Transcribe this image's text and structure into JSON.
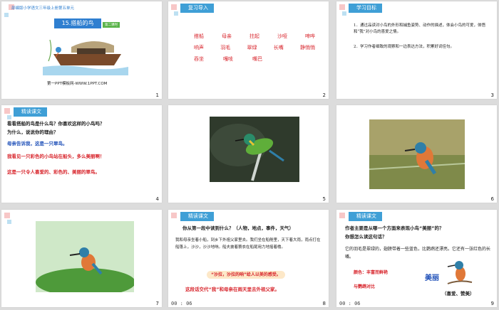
{
  "slides": [
    {
      "num": "1",
      "series": "部编版小学语文三年级上册第五单元",
      "title": "15.搭船的鸟",
      "badge": "第二课时",
      "footer": "第一PPT模板网-WWW.1PPT.COM"
    },
    {
      "num": "2",
      "tag": "复习导入",
      "rows": [
        [
          "搭船",
          "母亲",
          "拄起",
          "沙哑",
          "啼哗"
        ],
        [
          "响声",
          "羽毛",
          "翠绿",
          "长嘴",
          "静悄悄"
        ],
        [
          "吞坐",
          "嘎吱",
          "嘴巴"
        ]
      ]
    },
    {
      "num": "3",
      "tag": "学习目标",
      "goals": [
        "1．通过品读对小鸟的外形和捕鱼姿势、动作的描述，体会小鸟的可爱，体悟和“我”对小鸟的喜爱之情。",
        "2．学习作者细致的观察和一边表达方法，积累好词佳句。"
      ]
    },
    {
      "num": "4",
      "tag": "精读课文",
      "q1": "看看搭船的鸟是什么鸟？你喜欢这样的小鸟吗？",
      "q2": "为什么，说说你的理由？",
      "a1": "母亲告诉我，这是一只翠鸟。",
      "a2": "我看见一只彩色的小鸟站在船头，多么美丽啊！",
      "a3": "这是一只令人喜爱的、彩色的、美丽的翠鸟。"
    },
    {
      "num": "5"
    },
    {
      "num": "6"
    },
    {
      "num": "7"
    },
    {
      "num": "8",
      "timer": "00 : 06",
      "tag": "精读课文",
      "q": "你从第一段中读到什么？（人物，地点，事件，天气）",
      "p1": "我和母亲坐着小船，到乡下外祖父家里去。我们坐在船舱里，天下着大雨，雨点打在船篷上，沙沙，沙沙地响。船夫披着蓑衣在船尾用力地摇着橹。",
      "b1": "“沙拉，沙拉的响”给人以美的感受。",
      "b2": "这段话交代“我”和母亲在雨天里去外祖父家。"
    },
    {
      "num": "9",
      "timer": "00 : 06",
      "tag": "精读课文",
      "q1": "作者主要是从哪一个方面来表现小鸟“美丽”的？",
      "q2": "你想怎么读这句话？",
      "p1": "它的羽毛是翠绿的，翅膀带着一些蓝色，比鹦鹉还漂亮。它还有一张红色的长嘴。",
      "note": "颜色：丰富而鲜艳",
      "note2": "与鹦鹉对比",
      "big": "美丽",
      "end": "（喜爱、赞美）"
    }
  ],
  "colors": {
    "tag": "#3f9fd6",
    "red": "#d8262d",
    "blue": "#1e4fb8",
    "title_bg": "#2f7fd0"
  }
}
